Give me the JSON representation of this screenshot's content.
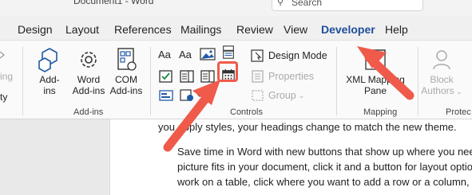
{
  "titlebar": {
    "doc_title": "Document1 - Word",
    "search_placeholder": "Search"
  },
  "tabs": [
    {
      "label": "Design",
      "active": false
    },
    {
      "label": "Layout",
      "active": false
    },
    {
      "label": "References",
      "active": false
    },
    {
      "label": "Mailings",
      "active": false
    },
    {
      "label": "Review",
      "active": false
    },
    {
      "label": "View",
      "active": false
    },
    {
      "label": "Developer",
      "active": true
    },
    {
      "label": "Help",
      "active": false
    }
  ],
  "ribbon": {
    "addins": {
      "group_label": "Add-ins",
      "addins_label_1": "Add-",
      "addins_label_2": "ins",
      "word_addins_1": "Word",
      "word_addins_2": "Add-ins",
      "com_addins_1": "COM",
      "com_addins_2": "Add-ins"
    },
    "controls": {
      "group_label": "Controls",
      "design_mode": "Design Mode",
      "properties": "Properties",
      "group": "Group"
    },
    "mapping": {
      "group_label": "Mapping",
      "xml_1": "XML Mapping",
      "xml_2": "Pane"
    },
    "protect": {
      "group_label": "Protec",
      "block_1": "Block",
      "block_2": "Authors"
    },
    "left_partial": {
      "line1": "ing",
      "line2": "ty"
    }
  },
  "document": {
    "line1": "you apply styles, your headings change to match the new theme.",
    "line2": "Save time in Word with new buttons that show up where you need",
    "line3": "picture fits in your document, click it and a button for layout option",
    "line4": "work on a table, click where you want to add a row or a column, an"
  },
  "colors": {
    "accent": "#1e4e9c",
    "annotation": "#ef5a4a"
  }
}
